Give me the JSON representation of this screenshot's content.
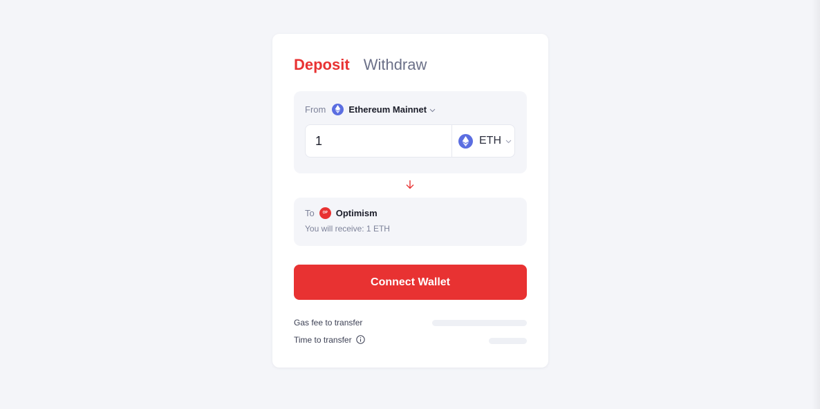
{
  "tabs": {
    "deposit": "Deposit",
    "withdraw": "Withdraw"
  },
  "from": {
    "label": "From",
    "network": "Ethereum Mainnet",
    "network_icon": "ethereum-icon",
    "amount": "1",
    "token": "ETH",
    "token_icon": "ethereum-icon"
  },
  "to": {
    "label": "To",
    "network": "Optimism",
    "network_icon": "optimism-icon",
    "badge_text": "OP",
    "receive_text": "You will receive: 1 ETH"
  },
  "connect_button": "Connect Wallet",
  "fees": {
    "gas_label": "Gas fee to transfer",
    "time_label": "Time to transfer"
  },
  "colors": {
    "accent": "#e83232",
    "background": "#f4f5f9",
    "eth_blue": "#5b6ee1"
  }
}
